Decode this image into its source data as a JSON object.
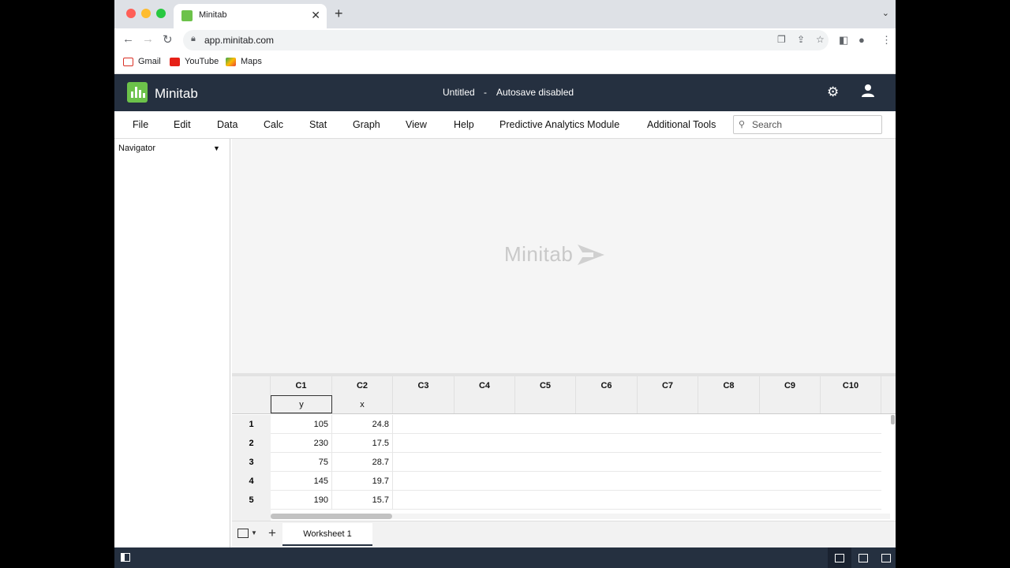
{
  "browser": {
    "tab_title": "Minitab",
    "url": "app.minitab.com",
    "bookmarks": [
      "Gmail",
      "YouTube",
      "Maps"
    ]
  },
  "app": {
    "name": "Minitab",
    "document": "Untitled",
    "separator": "-",
    "autosave": "Autosave disabled"
  },
  "menu": {
    "items": [
      "File",
      "Edit",
      "Data",
      "Calc",
      "Stat",
      "Graph",
      "View",
      "Help",
      "Predictive Analytics Module",
      "Additional Tools"
    ],
    "search_placeholder": "Search"
  },
  "navigator": {
    "title": "Navigator"
  },
  "output": {
    "watermark": "Minitab"
  },
  "worksheet": {
    "columns": [
      "C1",
      "C2",
      "C3",
      "C4",
      "C5",
      "C6",
      "C7",
      "C8",
      "C9",
      "C10"
    ],
    "names": [
      "y",
      "x",
      "",
      "",
      "",
      "",
      "",
      "",
      "",
      ""
    ],
    "rows": [
      {
        "num": "1",
        "y": "105",
        "x": "24.8"
      },
      {
        "num": "2",
        "y": "230",
        "x": "17.5"
      },
      {
        "num": "3",
        "y": "75",
        "x": "28.7"
      },
      {
        "num": "4",
        "y": "145",
        "x": "19.7"
      },
      {
        "num": "5",
        "y": "190",
        "x": "15.7"
      }
    ],
    "sheet_tab": "Worksheet 1"
  },
  "colors": {
    "header_bg": "#253040",
    "brand_green": "#6cc24a"
  }
}
